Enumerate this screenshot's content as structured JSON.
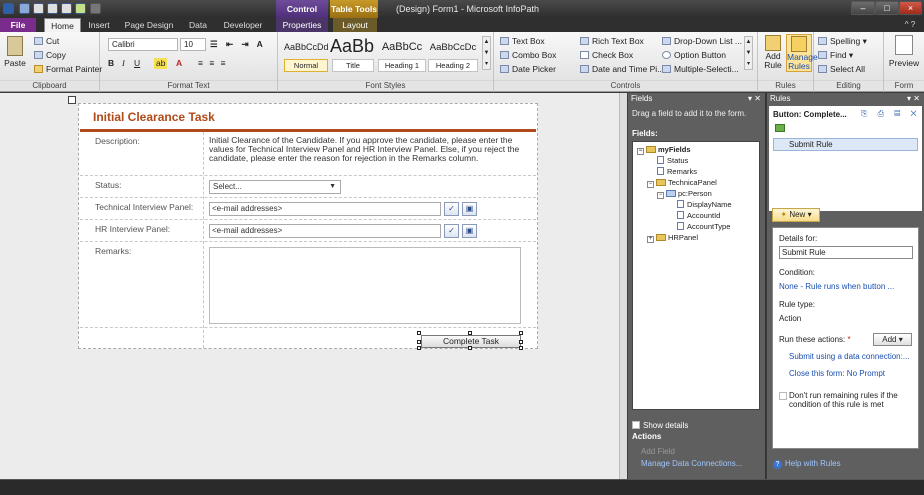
{
  "window": {
    "title": "(Design) Form1 - Microsoft InfoPath",
    "context_tabs": [
      "Control Tools",
      "Table Tools"
    ],
    "context_subtabs": [
      "Properties",
      "Layout"
    ]
  },
  "tabs": [
    "File",
    "Home",
    "Insert",
    "Page Design",
    "Data",
    "Developer"
  ],
  "ribbon": {
    "clipboard": {
      "paste": "Paste",
      "cut": "Cut",
      "copy": "Copy",
      "format_painter": "Format Painter",
      "label": "Clipboard"
    },
    "format_text": {
      "font": "Calibri",
      "size": "10",
      "label": "Format Text"
    },
    "font_styles": {
      "styles": [
        {
          "preview": "AaBbCcDd",
          "name": "Normal"
        },
        {
          "preview": "AaBb",
          "name": "Title"
        },
        {
          "preview": "AaBbCc",
          "name": "Heading 1"
        },
        {
          "preview": "AaBbCcDc",
          "name": "Heading 2"
        }
      ],
      "label": "Font Styles"
    },
    "controls": {
      "items": [
        "Text Box",
        "Combo Box",
        "Date Picker",
        "Rich Text Box",
        "Check Box",
        "Date and Time Pi...",
        "Drop-Down List ...",
        "Option Button",
        "Multiple-Selecti..."
      ],
      "label": "Controls"
    },
    "rules": {
      "add_rule": "Add\nRule",
      "manage_rules": "Manage\nRules",
      "label": "Rules"
    },
    "editing": {
      "spelling": "Spelling",
      "find": "Find",
      "select_all": "Select All",
      "label": "Editing"
    },
    "form": {
      "preview": "Preview",
      "label": "Form"
    }
  },
  "form": {
    "title": "Initial Clearance Task",
    "description_label": "Description:",
    "description_text": "Initial Clearance of the Candidate. If you approve the candidate, please enter the values for Technical Interview Panel and HR Interview Panel. Else, if you reject the candidate, please enter the reason for rejection in the Remarks column.",
    "status_label": "Status:",
    "status_value": "Select...",
    "tech_label": "Technical Interview Panel:",
    "tech_value": "<e-mail addresses>",
    "hr_label": "HR Interview Panel:",
    "hr_value": "<e-mail addresses>",
    "remarks_label": "Remarks:",
    "complete_button": "Complete Task"
  },
  "fields_pane": {
    "title": "Fields",
    "hint": "Drag a field to add it to the form.",
    "fields_label": "Fields:",
    "tree": [
      {
        "name": "myFields",
        "type": "folder",
        "level": 0
      },
      {
        "name": "Status",
        "type": "field",
        "level": 1
      },
      {
        "name": "Remarks",
        "type": "field",
        "level": 1
      },
      {
        "name": "TechnicaPanel",
        "type": "folder",
        "level": 1
      },
      {
        "name": "pc:Person",
        "type": "folder",
        "level": 2
      },
      {
        "name": "DisplayName",
        "type": "field",
        "level": 3
      },
      {
        "name": "AccountId",
        "type": "field",
        "level": 3
      },
      {
        "name": "AccountType",
        "type": "field",
        "level": 3
      },
      {
        "name": "HRPanel",
        "type": "folder",
        "level": 1
      }
    ],
    "show_details": "Show details",
    "actions_label": "Actions",
    "add_field": "Add Field",
    "manage_connections": "Manage Data Connections..."
  },
  "rules_pane": {
    "title": "Rules",
    "button_name": "Button: Complete...",
    "rule_item": "Submit Rule",
    "new_button": "New",
    "details_for": "Details for:",
    "rule_name": "Submit Rule",
    "condition_label": "Condition:",
    "condition_value": "None - Rule runs when button ...",
    "rule_type_label": "Rule type:",
    "rule_type_value": "Action",
    "run_actions_label": "Run these actions:",
    "add_button": "Add",
    "action_1": "Submit using a data connection:...",
    "action_2": "Close this form: No Prompt",
    "dont_run": "Don't run remaining rules if the condition of this rule is met",
    "help": "Help with Rules"
  }
}
